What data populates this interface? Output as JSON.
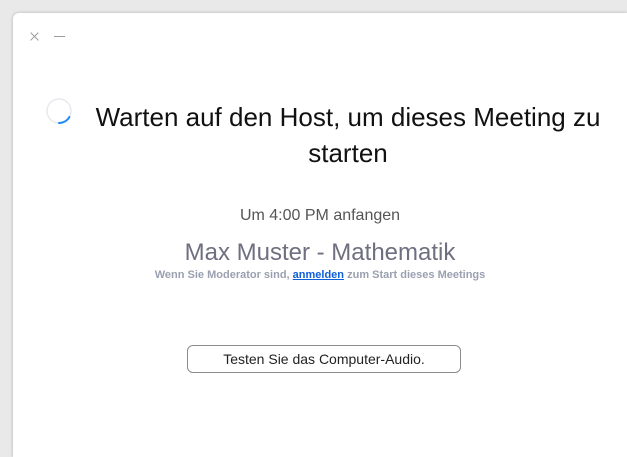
{
  "window": {
    "controls": {
      "close_icon": "close-icon",
      "minimize_icon": "minimize-icon"
    }
  },
  "main": {
    "title": "Warten auf den Host, um dieses Meeting zu starten",
    "start_time": "Um 4:00 PM anfangen",
    "meeting_name": "Max Muster - Mathematik",
    "moderator_note": {
      "prefix": "Wenn Sie Moderator sind,",
      "link": "anmelden",
      "suffix": "zum Start dieses Meetings"
    },
    "audio_button_label": "Testen Sie das Computer-Audio."
  },
  "colors": {
    "link": "#0e5fd8",
    "spinner": "#1a8cff",
    "meeting_name": "#6f6f80"
  }
}
